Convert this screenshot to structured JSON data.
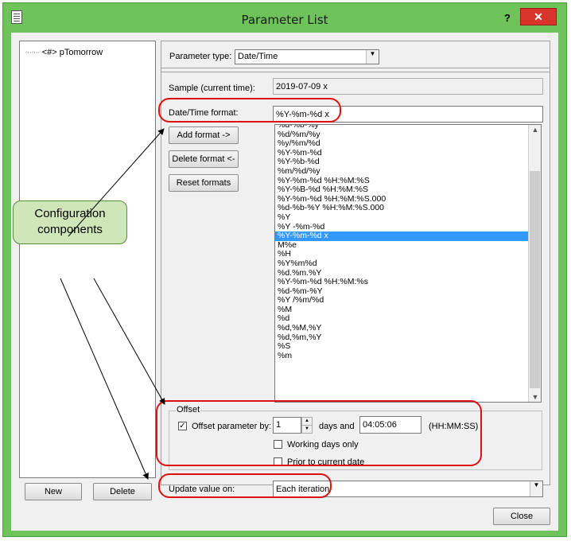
{
  "window": {
    "title": "Parameter List",
    "help_label": "?",
    "close_label": "✕"
  },
  "tree": {
    "items": [
      {
        "prefix": "<#>",
        "label": "pTomorrow"
      }
    ]
  },
  "left_buttons": {
    "new_label": "New",
    "delete_label": "Delete"
  },
  "parameter_type": {
    "label": "Parameter type:",
    "value": "Date/Time"
  },
  "sample": {
    "label": "Sample (current time):",
    "value": "2019-07-09 x"
  },
  "format": {
    "label": "Date/Time format:",
    "value": "%Y-%m-%d x",
    "add_label": "Add format ->",
    "delete_label": "Delete format <-",
    "reset_label": "Reset formats",
    "options": [
      "%d-%b-%y",
      "%d/%m/%y",
      "%y/%m/%d",
      "%Y-%m-%d",
      "%Y-%b-%d",
      "%m/%d/%y",
      "%Y-%m-%d %H:%M:%S",
      "%Y-%B-%d %H:%M:%S",
      "%Y-%m-%d %H:%M:%S.000",
      "%d-%b-%Y %H:%M:%S.000",
      "%Y",
      "%Y -%m-%d",
      "%Y-%m-%d x",
      "M%e",
      "%H",
      "%Y%m%d",
      "%d.%m.%Y",
      "%Y-%m-%d %H:%M:%s",
      "%d-%m-%Y",
      "%Y /%m/%d",
      "%M",
      "%d",
      "%d,%M,%Y",
      "%d,%m,%Y",
      "%S",
      "%m"
    ],
    "selected_index": 12
  },
  "offset": {
    "group_label": "Offset",
    "param_label": "Offset parameter by:",
    "param_checked": "✓",
    "days_value": "1",
    "days_label": "days and",
    "time_value": "04:05:06",
    "time_unit": "(HH:MM:SS)",
    "working_days_label": "Working days only",
    "prior_label": "Prior to current date"
  },
  "update": {
    "label": "Update value on:",
    "value": "Each iteration"
  },
  "close_button_label": "Close",
  "annotation": {
    "callout_line1": "Configuration",
    "callout_line2": "components"
  },
  "colors": {
    "window_frame": "#6ec35a",
    "highlight": "#e01010",
    "selection": "#3399ff",
    "callout_fill": "#cfe6b8"
  }
}
